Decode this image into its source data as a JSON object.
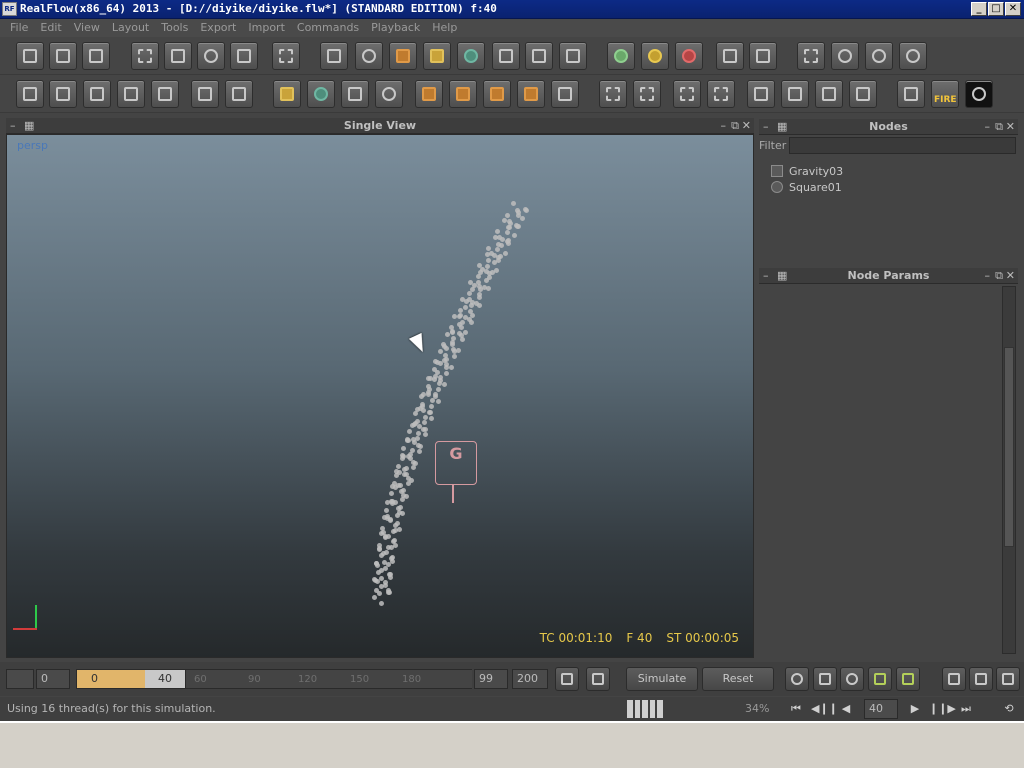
{
  "window": {
    "title": "RealFlow(x86_64) 2013 - [D://diyike/diyike.flw*] (STANDARD EDITION) f:40",
    "app_icon_text": "RF",
    "minimize": "_",
    "maximize": "□",
    "close": "✕"
  },
  "menu": [
    "File",
    "Edit",
    "View",
    "Layout",
    "Tools",
    "Export",
    "Import",
    "Commands",
    "Playback",
    "Help"
  ],
  "viewport": {
    "panel_title": "Single View",
    "camera_label": "persp",
    "timecode": "TC 00:01:10",
    "frame": "F 40",
    "sim_time": "ST 00:00:05",
    "gravity_glyph": "G"
  },
  "nodes_panel": {
    "title": "Nodes",
    "filter_label": "Filter",
    "nodes": [
      {
        "label": "Gravity03",
        "icon": "gravity-daemon-icon"
      },
      {
        "label": "Square01",
        "icon": "particle-emitter-icon"
      }
    ]
  },
  "params_panel": {
    "title": "Node Params"
  },
  "panel_controls": {
    "minimize": "–",
    "float": "⧉",
    "close": "✕",
    "grip": "▦"
  },
  "timeline": {
    "start": "0",
    "range_start": "0",
    "current": "40",
    "ticks": [
      "60",
      "90",
      "120",
      "150",
      "180"
    ],
    "end_visible": "99",
    "end_total": "200",
    "simulate_label": "Simulate",
    "reset_label": "Reset"
  },
  "status": {
    "message": "Using 16 thread(s) for this simulation.",
    "percent": "34%",
    "frame_value": "40"
  },
  "playback": {
    "to_start": "⏮",
    "step_back": "◀❙❙",
    "play_back": "◀",
    "play": "▶",
    "step_fwd": "❙❙▶",
    "to_end": "⏭",
    "loop": "⟲"
  },
  "toolbar": {
    "fire_label": "FIRE"
  },
  "colors": {
    "accent_hud": "#e6c84a",
    "camera_label": "#4a78b8",
    "gravity": "#d59aa0"
  }
}
